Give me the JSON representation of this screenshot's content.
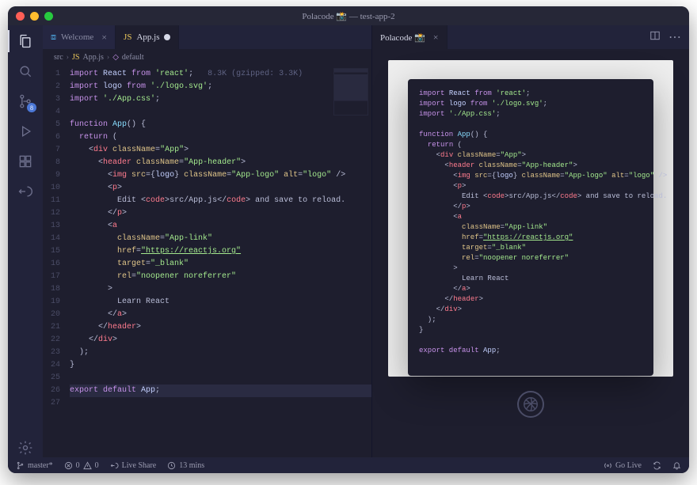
{
  "window": {
    "title": "Polacode 📸 — test-app-2"
  },
  "activitybar": {
    "items": [
      {
        "name": "explorer",
        "active": true
      },
      {
        "name": "search"
      },
      {
        "name": "scm",
        "badge": "8"
      },
      {
        "name": "debug"
      },
      {
        "name": "extensions"
      },
      {
        "name": "liveshare"
      }
    ],
    "bottom": [
      {
        "name": "settings"
      }
    ]
  },
  "tabs": {
    "left": [
      {
        "label": "Welcome",
        "icon": "vs",
        "active": false,
        "dirty": false
      },
      {
        "label": "App.js",
        "icon": "js",
        "active": true,
        "dirty": true
      }
    ],
    "right": [
      {
        "label": "Polacode 📸",
        "icon": "",
        "active": true,
        "dirty": false
      }
    ]
  },
  "breadcrumbs": {
    "parts": [
      "src",
      "App.js",
      "default"
    ],
    "file_icon": "JS"
  },
  "editor": {
    "hint": "8.3K (gzipped: 3.3K)",
    "lines": [
      [
        [
          "kw",
          "import "
        ],
        [
          "id",
          "React"
        ],
        [
          "kw",
          " from "
        ],
        [
          "str",
          "'react'"
        ],
        [
          "pun",
          ";   "
        ],
        [
          "cmt",
          "8.3K (gzipped: 3.3K)"
        ]
      ],
      [
        [
          "kw",
          "import "
        ],
        [
          "id",
          "logo"
        ],
        [
          "kw",
          " from "
        ],
        [
          "str",
          "'./logo.svg'"
        ],
        [
          "pun",
          ";"
        ]
      ],
      [
        [
          "kw",
          "import "
        ],
        [
          "str",
          "'./App.css'"
        ],
        [
          "pun",
          ";"
        ]
      ],
      [],
      [
        [
          "kw",
          "function "
        ],
        [
          "fn",
          "App"
        ],
        [
          "pun",
          "() {"
        ]
      ],
      [
        [
          "pun",
          "  "
        ],
        [
          "kw",
          "return"
        ],
        [
          "pun",
          " ("
        ]
      ],
      [
        [
          "pun",
          "    <"
        ],
        [
          "tag",
          "div"
        ],
        [
          "attr",
          " className"
        ],
        [
          "pun",
          "="
        ],
        [
          "str",
          "\"App\""
        ],
        [
          "pun",
          ">"
        ]
      ],
      [
        [
          "pun",
          "      <"
        ],
        [
          "tag",
          "header"
        ],
        [
          "attr",
          " className"
        ],
        [
          "pun",
          "="
        ],
        [
          "str",
          "\"App-header\""
        ],
        [
          "pun",
          ">"
        ]
      ],
      [
        [
          "pun",
          "        <"
        ],
        [
          "tag",
          "img"
        ],
        [
          "attr",
          " src"
        ],
        [
          "pun",
          "={"
        ],
        [
          "id",
          "logo"
        ],
        [
          "pun",
          "}"
        ],
        [
          "attr",
          " className"
        ],
        [
          "pun",
          "="
        ],
        [
          "str",
          "\"App-logo\""
        ],
        [
          "attr",
          " alt"
        ],
        [
          "pun",
          "="
        ],
        [
          "str",
          "\"logo\""
        ],
        [
          "pun",
          " />"
        ]
      ],
      [
        [
          "pun",
          "        <"
        ],
        [
          "tag",
          "p"
        ],
        [
          "pun",
          ">"
        ]
      ],
      [
        [
          "txt",
          "          Edit "
        ],
        [
          "pun",
          "<"
        ],
        [
          "tag",
          "code"
        ],
        [
          "pun",
          ">"
        ],
        [
          "txt",
          "src/App.js"
        ],
        [
          "pun",
          "</"
        ],
        [
          "tag",
          "code"
        ],
        [
          "pun",
          ">"
        ],
        [
          "txt",
          " and save to reload."
        ]
      ],
      [
        [
          "pun",
          "        </"
        ],
        [
          "tag",
          "p"
        ],
        [
          "pun",
          ">"
        ]
      ],
      [
        [
          "pun",
          "        <"
        ],
        [
          "tag",
          "a"
        ]
      ],
      [
        [
          "attr",
          "          className"
        ],
        [
          "pun",
          "="
        ],
        [
          "str",
          "\"App-link\""
        ]
      ],
      [
        [
          "attr",
          "          href"
        ],
        [
          "pun",
          "="
        ],
        [
          "str u",
          "\"https://reactjs.org\""
        ]
      ],
      [
        [
          "attr",
          "          target"
        ],
        [
          "pun",
          "="
        ],
        [
          "str",
          "\"_blank\""
        ]
      ],
      [
        [
          "attr",
          "          rel"
        ],
        [
          "pun",
          "="
        ],
        [
          "str",
          "\"noopener noreferrer\""
        ]
      ],
      [
        [
          "pun",
          "        >"
        ]
      ],
      [
        [
          "txt",
          "          Learn React"
        ]
      ],
      [
        [
          "pun",
          "        </"
        ],
        [
          "tag",
          "a"
        ],
        [
          "pun",
          ">"
        ]
      ],
      [
        [
          "pun",
          "      </"
        ],
        [
          "tag",
          "header"
        ],
        [
          "pun",
          ">"
        ]
      ],
      [
        [
          "pun",
          "    </"
        ],
        [
          "tag",
          "div"
        ],
        [
          "pun",
          ">"
        ]
      ],
      [
        [
          "pun",
          "  );"
        ]
      ],
      [
        [
          "pun",
          "}"
        ]
      ],
      [],
      [
        [
          "kw",
          "export default "
        ],
        [
          "id",
          "App"
        ],
        [
          "pun",
          ";"
        ]
      ],
      []
    ],
    "highlight_line": 26
  },
  "polacode": {
    "lines_source": "editor.lines"
  },
  "statusbar": {
    "left": [
      {
        "icon": "branch",
        "text": "master*"
      },
      {
        "icon": "err",
        "text": "0"
      },
      {
        "icon": "warn",
        "text": "0"
      },
      {
        "icon": "live",
        "text": "Live Share"
      },
      {
        "icon": "clock",
        "text": "13 mins"
      }
    ],
    "right": [
      {
        "icon": "broadcast",
        "text": "Go Live"
      },
      {
        "icon": "sync",
        "text": ""
      },
      {
        "icon": "bell",
        "text": ""
      }
    ]
  }
}
